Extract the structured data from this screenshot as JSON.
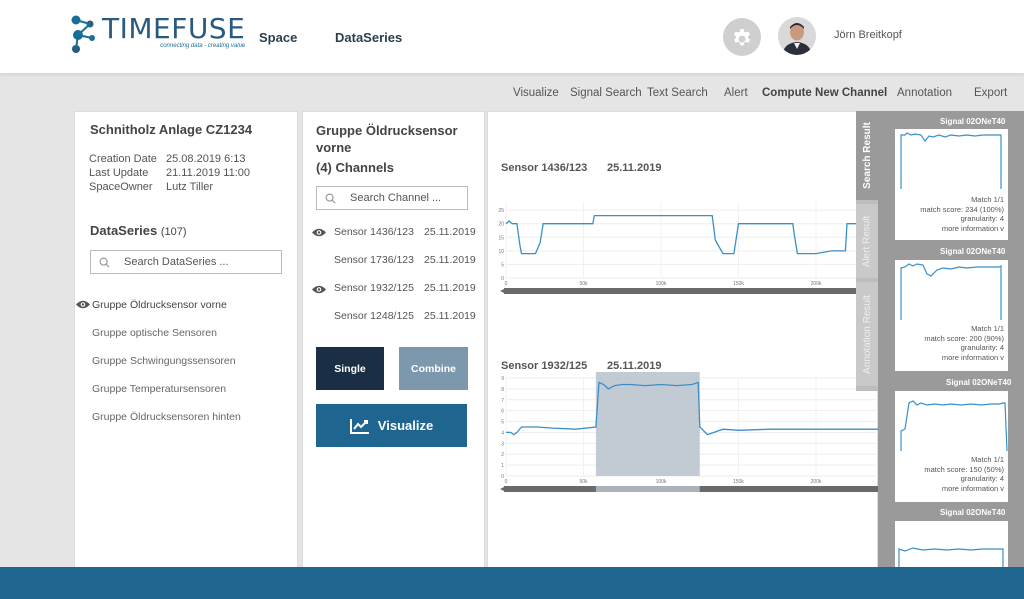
{
  "brand": {
    "name": "TIMEFUSE",
    "tagline": "connecting data - creating value"
  },
  "nav": {
    "space": "Space",
    "dataseries": "DataSeries"
  },
  "user": {
    "name": "Jörn Breitkopf"
  },
  "toolbar": {
    "visualize": "Visualize",
    "signal_search": "Signal Search",
    "text_search": "Text Search",
    "alert": "Alert",
    "compute_new_channel": "Compute New Channel",
    "annotation": "Annotation",
    "export": "Export"
  },
  "space": {
    "title": "Schnitholz Anlage CZ1234",
    "meta": [
      {
        "key": "Creation Date",
        "value": "25.08.2019 6:13"
      },
      {
        "key": "Last Update",
        "value": "21.11.2019 11:00"
      },
      {
        "key": "SpaceOwner",
        "value": "Lutz Tiller"
      }
    ],
    "dataseries_label": "DataSeries",
    "dataseries_count": "(107)",
    "search_placeholder": "Search  DataSeries ...",
    "groups": [
      "Gruppe Öldrucksensor vorne",
      "Gruppe optische Sensoren",
      "Gruppe Schwingungssensoren",
      "Gruppe Temperatursensoren",
      "Gruppe Öldrucksensoren hinten"
    ]
  },
  "group": {
    "title": "Gruppe Öldrucksensor vorne",
    "count": "(4) Channels",
    "search_placeholder": "Search  Channel ...",
    "channels": [
      {
        "name": "Sensor 1436/123",
        "date": "25.11.2019",
        "visible": true
      },
      {
        "name": "Sensor 1736/123",
        "date": "25.11.2019",
        "visible": false
      },
      {
        "name": "Sensor 1932/125",
        "date": "25.11.2019",
        "visible": true
      },
      {
        "name": "Sensor 1248/125",
        "date": "25.11.2019",
        "visible": false
      }
    ],
    "single_label": "Single",
    "combine_label": "Combine",
    "visualize_label": "Visualize"
  },
  "charts": [
    {
      "sensor": "Sensor 1436/123",
      "date": "25.11.2019"
    },
    {
      "sensor": "Sensor 1932/125",
      "date": "25.11.2019"
    }
  ],
  "chart_data": [
    {
      "type": "line",
      "title": "Sensor 1436/123",
      "x_ticks": [
        "0",
        "50k",
        "100k",
        "150k",
        "200k"
      ],
      "y_ticks": [
        "0",
        "5",
        "10",
        "15",
        "20",
        "25"
      ],
      "ylim": [
        0,
        28
      ],
      "xlim": [
        0,
        240000
      ],
      "grid": true,
      "series": [
        {
          "x": [
            0,
            2000,
            4000,
            6000,
            7000,
            9000,
            10000,
            18000,
            19000,
            22000,
            24000,
            26000,
            30000,
            40000,
            52000,
            56000,
            57000,
            59000,
            62000,
            70000,
            80000,
            90000,
            100000,
            112000,
            120000,
            128000,
            133000,
            135000,
            137000,
            140000,
            142000,
            147000,
            150000,
            170000,
            182000,
            185000,
            186000,
            188000,
            190000,
            200000,
            210000,
            219000,
            220000,
            221000,
            240000
          ],
          "y": [
            20,
            21,
            20,
            20,
            20,
            12,
            9,
            9,
            9,
            13,
            20,
            20,
            20,
            20,
            20,
            20,
            23,
            23,
            23,
            23,
            23,
            23,
            23,
            23,
            23,
            23,
            23,
            14,
            12,
            9,
            9,
            9,
            20,
            20,
            20,
            20,
            16,
            9,
            9,
            9,
            10,
            10,
            20,
            20,
            20
          ]
        }
      ]
    },
    {
      "type": "line",
      "title": "Sensor 1932/125",
      "x_ticks": [
        "0",
        "50k",
        "100k",
        "150k",
        "200k"
      ],
      "y_ticks": [
        "0",
        "1",
        "2",
        "3",
        "4",
        "5",
        "6",
        "7",
        "8",
        "9"
      ],
      "ylim": [
        0,
        9
      ],
      "xlim": [
        0,
        240000
      ],
      "grid": true,
      "highlight_range": [
        58000,
        125000
      ],
      "series": [
        {
          "x": [
            0,
            3000,
            5000,
            7000,
            10000,
            20000,
            30000,
            45000,
            58000,
            60000,
            63000,
            66000,
            70000,
            75000,
            80000,
            90000,
            100000,
            110000,
            120000,
            124000,
            125000,
            130000,
            140000,
            150000,
            170000,
            190000,
            210000,
            220000,
            240000
          ],
          "y": [
            4,
            4,
            3.8,
            4,
            4.5,
            4.5,
            4.4,
            4.3,
            4.5,
            8.6,
            8.4,
            8,
            8.3,
            8.4,
            8.4,
            8.3,
            8.4,
            8.3,
            8.4,
            8.6,
            4.5,
            3.8,
            4.3,
            4.2,
            4.3,
            4.3,
            4.3,
            4.3,
            4.3
          ]
        }
      ]
    }
  ],
  "results": {
    "tabs": [
      "Search Result",
      "Alert Result",
      "Annotation Result"
    ],
    "items": [
      {
        "signal": "Signal 02ONeT40",
        "match": "Match 1/1",
        "score": "match score: 234 (100%)",
        "granularity": "granularity: 4",
        "more": "more information v"
      },
      {
        "signal": "Signal 02ONeT40",
        "match": "Match 1/1",
        "score": "match score: 200 (90%)",
        "granularity": "granularity: 4",
        "more": "more information v"
      },
      {
        "signal": "Signal 02ONeT40",
        "match": "Match 1/1",
        "score": "match score: 150 (50%)",
        "granularity": "granularity: 4",
        "more": "more information v"
      },
      {
        "signal": "Signal 02ONeT40",
        "match": "",
        "score": "",
        "granularity": "",
        "more": ""
      }
    ]
  },
  "colors": {
    "accent": "#1e6690",
    "dark": "#1a2e45",
    "combine": "#7b98ad",
    "line": "#3a8fc8"
  }
}
